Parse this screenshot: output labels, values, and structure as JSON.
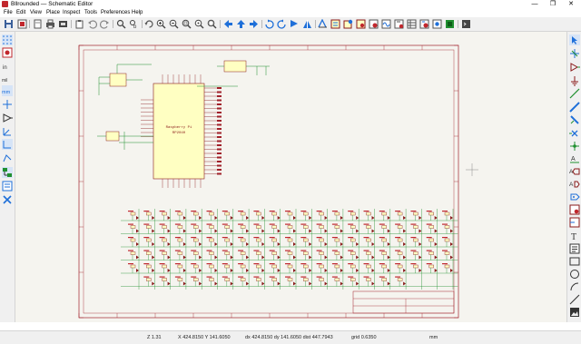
{
  "window": {
    "title": "Bllrounded — Schematic Editor",
    "minimize_glyph": "—",
    "maximize_glyph": "❐",
    "close_glyph": "✕"
  },
  "menu": [
    "File",
    "Edit",
    "View",
    "Place",
    "Inspect",
    "Tools",
    "Preferences",
    "Help"
  ],
  "schematic": {
    "mcu_name": "Raspberry Pi",
    "mcu_part": "RP2040"
  },
  "status": {
    "zoom": "Z 1.31",
    "cursor": "X 424.8150  Y 141.6050",
    "delta": "dx 424.8150  dy 141.6050  dist 447.7943",
    "grid": "grid 0.6350",
    "units": "mm"
  },
  "colors": {
    "canvas_bg": "#f5f4ef",
    "sheet_border": "#a0202a",
    "wire": "#1f8f2f",
    "component": "#8a1a1a",
    "component_fill": "#ffffc2",
    "toolbar_bg": "#f0f0f0",
    "accent_blue": "#1e6fd9"
  }
}
